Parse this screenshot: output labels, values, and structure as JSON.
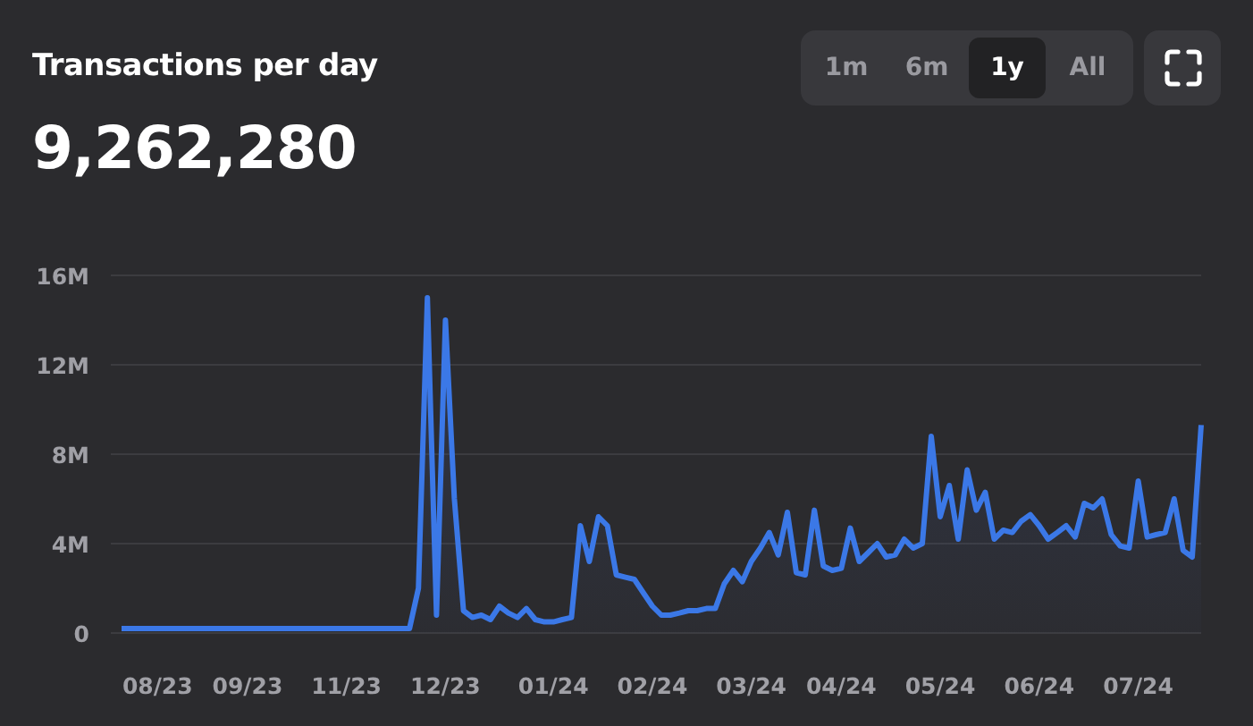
{
  "title": "Transactions per day",
  "value": "9,262,280",
  "ranges": [
    {
      "label": "1m",
      "selected": false
    },
    {
      "label": "6m",
      "selected": false
    },
    {
      "label": "1y",
      "selected": true
    },
    {
      "label": "All",
      "selected": false
    }
  ],
  "chart_data": {
    "type": "area",
    "grid": true,
    "ylim": [
      0,
      16
    ],
    "yticks": [
      {
        "value": 0,
        "label": "0"
      },
      {
        "value": 4,
        "label": "4M"
      },
      {
        "value": 8,
        "label": "8M"
      },
      {
        "value": 12,
        "label": "12M"
      },
      {
        "value": 16,
        "label": "16M"
      }
    ],
    "categories": [
      null,
      null,
      null,
      null,
      "08/23",
      null,
      null,
      null,
      null,
      null,
      null,
      null,
      null,
      null,
      "09/23",
      null,
      null,
      null,
      null,
      null,
      null,
      null,
      null,
      null,
      null,
      "11/23",
      null,
      null,
      null,
      null,
      null,
      null,
      null,
      null,
      null,
      null,
      "12/23",
      null,
      null,
      null,
      null,
      null,
      null,
      null,
      null,
      null,
      null,
      null,
      "01/24",
      null,
      null,
      null,
      null,
      null,
      null,
      null,
      null,
      null,
      null,
      "02/24",
      null,
      null,
      null,
      null,
      null,
      null,
      null,
      null,
      null,
      null,
      "03/24",
      null,
      null,
      null,
      null,
      null,
      null,
      null,
      null,
      null,
      "04/24",
      null,
      null,
      null,
      null,
      null,
      null,
      null,
      null,
      null,
      null,
      "05/24",
      null,
      null,
      null,
      null,
      null,
      null,
      null,
      null,
      null,
      null,
      "06/24",
      null,
      null,
      null,
      null,
      null,
      null,
      null,
      null,
      null,
      null,
      "07/24",
      null,
      null,
      null,
      null,
      null,
      null,
      null
    ],
    "series": [
      {
        "color": "#3b78e7",
        "values": [
          0.2,
          0.2,
          0.2,
          0.2,
          0.2,
          0.2,
          0.2,
          0.2,
          0.2,
          0.2,
          0.2,
          0.2,
          0.2,
          0.2,
          0.2,
          0.2,
          0.2,
          0.2,
          0.2,
          0.2,
          0.2,
          0.2,
          0.2,
          0.2,
          0.2,
          0.2,
          0.2,
          0.2,
          0.2,
          0.2,
          0.2,
          0.2,
          0.2,
          2,
          15,
          0.8,
          14,
          6,
          1,
          0.7,
          0.8,
          0.6,
          1.2,
          0.9,
          0.7,
          1.1,
          0.6,
          0.5,
          0.5,
          0.6,
          0.7,
          4.8,
          3.2,
          5.2,
          4.8,
          2.6,
          2.5,
          2.4,
          1.8,
          1.2,
          0.8,
          0.8,
          0.9,
          1.0,
          1.0,
          1.1,
          1.1,
          2.2,
          2.8,
          2.3,
          3.2,
          3.8,
          4.5,
          3.5,
          5.4,
          2.7,
          2.6,
          5.5,
          3.0,
          2.8,
          2.9,
          4.7,
          3.2,
          3.6,
          4.0,
          3.4,
          3.5,
          4.2,
          3.8,
          4.0,
          8.8,
          5.2,
          6.6,
          4.2,
          7.3,
          5.5,
          6.3,
          4.2,
          4.6,
          4.5,
          5.0,
          5.3,
          4.8,
          4.2,
          4.5,
          4.8,
          4.3,
          5.8,
          5.6,
          6.0,
          4.4,
          3.9,
          3.8,
          6.8,
          4.3,
          4.4,
          4.5,
          6.0,
          3.7,
          3.4,
          9.3
        ]
      }
    ]
  }
}
